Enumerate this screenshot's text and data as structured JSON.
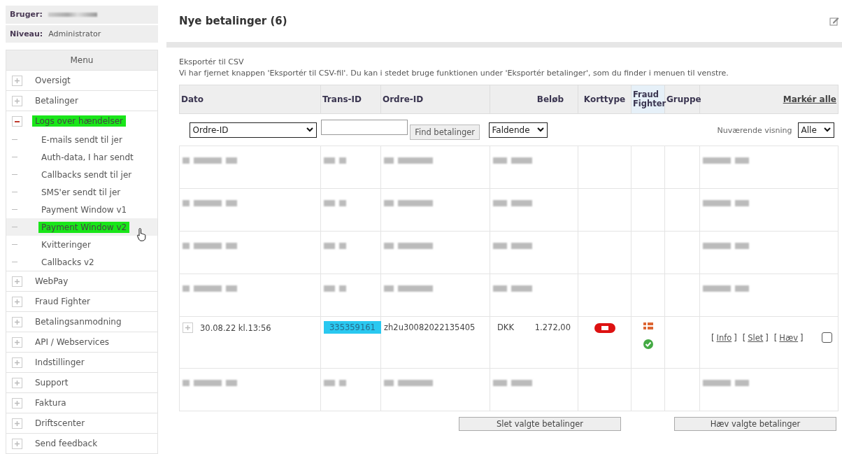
{
  "user": {
    "label": "Bruger:"
  },
  "level": {
    "label": "Niveau:",
    "value": "Administrator"
  },
  "menu": {
    "title": "Menu",
    "items": [
      {
        "label": "Oversigt",
        "expanded": false,
        "selected": false
      },
      {
        "label": "Betalinger",
        "expanded": false,
        "selected": false
      },
      {
        "label": "Logs over hændelser",
        "expanded": true,
        "selected": true,
        "children": [
          {
            "label": "E-mails sendt til jer",
            "selected": false
          },
          {
            "label": "Auth-data, I har sendt",
            "selected": false
          },
          {
            "label": "Callbacks sendt til jer",
            "selected": false
          },
          {
            "label": "SMS'er sendt til jer",
            "selected": false
          },
          {
            "label": "Payment Window v1",
            "selected": false
          },
          {
            "label": "Payment Window v2",
            "selected": true
          },
          {
            "label": "Kvitteringer",
            "selected": false
          },
          {
            "label": "Callbacks v2",
            "selected": false
          }
        ]
      },
      {
        "label": "WebPay",
        "expanded": false,
        "selected": false
      },
      {
        "label": "Fraud Fighter",
        "expanded": false,
        "selected": false
      },
      {
        "label": "Betalingsanmodning",
        "expanded": false,
        "selected": false
      },
      {
        "label": "API / Webservices",
        "expanded": false,
        "selected": false
      },
      {
        "label": "Indstillinger",
        "expanded": false,
        "selected": false
      },
      {
        "label": "Support",
        "expanded": false,
        "selected": false
      },
      {
        "label": "Faktura",
        "expanded": false,
        "selected": false
      },
      {
        "label": "Driftscenter",
        "expanded": false,
        "selected": false
      },
      {
        "label": "Send feedback",
        "expanded": false,
        "selected": false
      }
    ]
  },
  "page": {
    "title": "Nye betalinger (6)",
    "export_title": "Eksportér til CSV",
    "export_note": "Vi har fjernet knappen 'Eksportér til CSV-fil'. Du kan i stedet bruge funktionen under 'Eksportér betalinger', som du finder i menuen til venstre."
  },
  "table": {
    "columns": [
      "Dato",
      "Trans-ID",
      "Ordre-ID",
      "Beløb",
      "Korttype",
      "Fraud Fighter",
      "Gruppe"
    ],
    "mark_all": "Markér alle",
    "filter": {
      "field": "Ordre-ID",
      "search_button": "Find betalinger",
      "order": "Faldende",
      "view_label": "Nuværende visning",
      "view": "Alle"
    },
    "rows": [
      {
        "kind": "redacted"
      },
      {
        "kind": "redacted"
      },
      {
        "kind": "redacted"
      },
      {
        "kind": "redacted"
      },
      {
        "kind": "payment",
        "date": "30.08.22 kl.13:56",
        "trans_id": "335359161",
        "order_id": "zh2u30082022135405",
        "currency": "DKK",
        "amount": "1.272,00",
        "links": [
          {
            "open": "[",
            "label": "Info",
            "close": "]"
          },
          {
            "open": "[",
            "label": "Slet",
            "close": "]"
          },
          {
            "open": "[",
            "label": "Hæv",
            "close": "]"
          }
        ],
        "checked": false
      },
      {
        "kind": "redacted"
      }
    ],
    "buttons": [
      "Slet valgte betalinger",
      "Hæv valgte betalinger"
    ]
  }
}
